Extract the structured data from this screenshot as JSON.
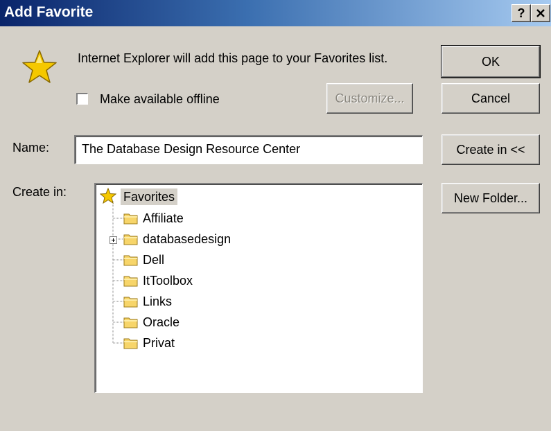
{
  "window": {
    "title": "Add Favorite",
    "help_button": "?",
    "close_button": "✕"
  },
  "dialog": {
    "message": "Internet Explorer will add this page to your Favorites list.",
    "offline_label": "Make available offline",
    "offline_checked": false,
    "name_label": "Name:",
    "name_value": "The Database Design Resource Center",
    "create_in_label": "Create in:"
  },
  "buttons": {
    "ok": "OK",
    "cancel": "Cancel",
    "customize": "Customize...",
    "create_in": "Create in <<",
    "new_folder": "New Folder..."
  },
  "tree": {
    "root": "Favorites",
    "items": [
      {
        "label": "Affiliate",
        "expandable": false
      },
      {
        "label": "databasedesign",
        "expandable": true
      },
      {
        "label": "Dell",
        "expandable": false
      },
      {
        "label": "ItToolbox",
        "expandable": false
      },
      {
        "label": "Links",
        "expandable": false
      },
      {
        "label": "Oracle",
        "expandable": false
      },
      {
        "label": "Privat",
        "expandable": false
      }
    ]
  },
  "colors": {
    "dialog_bg": "#d4d0c8",
    "title_start": "#0a246a",
    "title_end": "#a6caf0",
    "star": "#f5c800",
    "folder": "#f7d56a"
  }
}
